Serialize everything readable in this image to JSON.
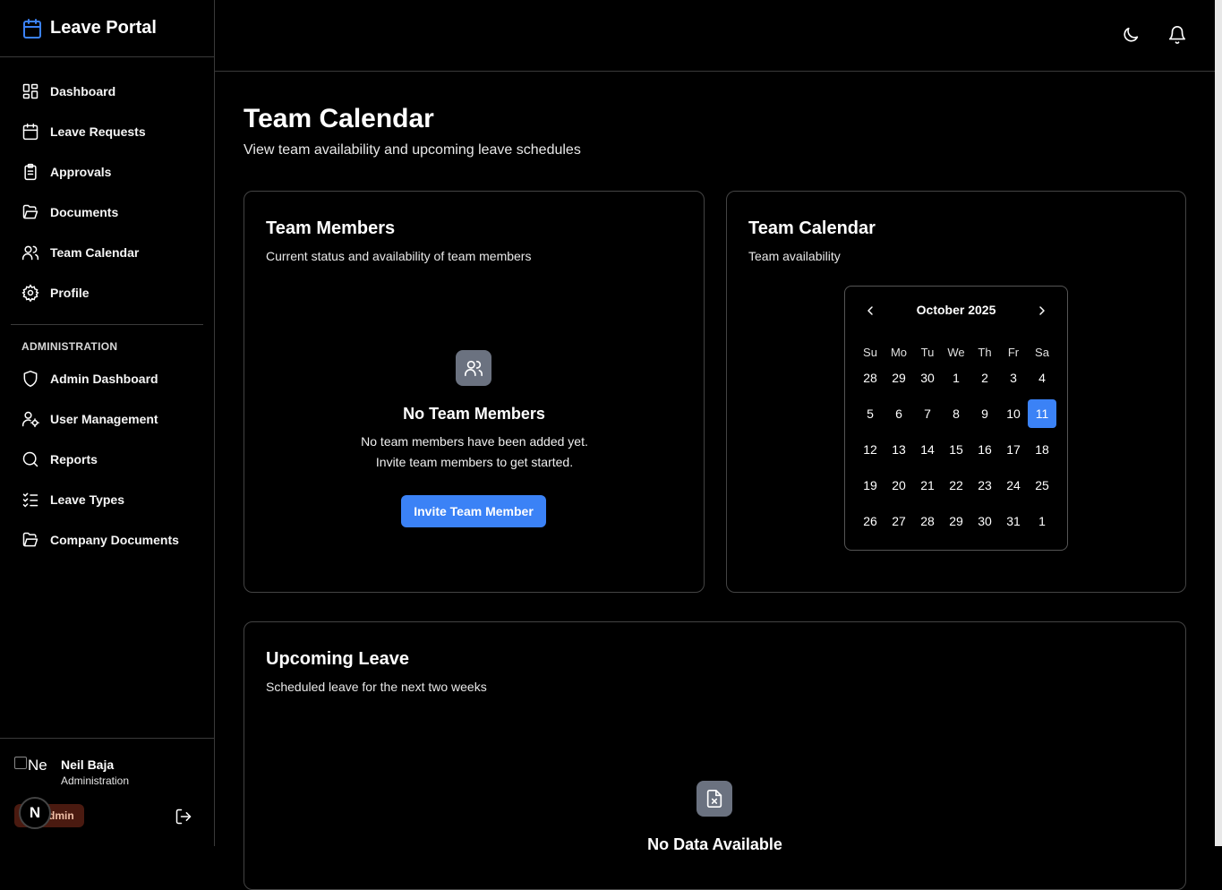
{
  "app": {
    "title": "Leave Portal"
  },
  "sidebar": {
    "items": [
      {
        "label": "Dashboard",
        "icon": "dashboard-icon"
      },
      {
        "label": "Leave Requests",
        "icon": "calendar-icon"
      },
      {
        "label": "Approvals",
        "icon": "clipboard-icon"
      },
      {
        "label": "Documents",
        "icon": "folder-open-icon"
      },
      {
        "label": "Team Calendar",
        "icon": "users-icon"
      },
      {
        "label": "Profile",
        "icon": "gear-icon"
      }
    ],
    "admin_section": "ADMINISTRATION",
    "admin_items": [
      {
        "label": "Admin Dashboard",
        "icon": "shield-icon"
      },
      {
        "label": "User Management",
        "icon": "user-cog-icon"
      },
      {
        "label": "Reports",
        "icon": "search-icon"
      },
      {
        "label": "Leave Types",
        "icon": "list-checks-icon"
      },
      {
        "label": "Company Documents",
        "icon": "folder-open-icon"
      }
    ],
    "user": {
      "name": "Neil Baja",
      "role": "Administration",
      "avatar_alt": "Ne",
      "badge": "dmin",
      "n_badge": "N"
    }
  },
  "page": {
    "title": "Team Calendar",
    "subtitle": "View team availability and upcoming leave schedules"
  },
  "team_members": {
    "title": "Team Members",
    "description": "Current status and availability of team members",
    "empty_title": "No Team Members",
    "empty_text": "No team members have been added yet. Invite team members to get started.",
    "button": "Invite Team Member"
  },
  "team_calendar": {
    "title": "Team Calendar",
    "description": "Team availability",
    "month": "October 2025",
    "weekdays": [
      "Su",
      "Mo",
      "Tu",
      "We",
      "Th",
      "Fr",
      "Sa"
    ],
    "weeks": [
      [
        "28",
        "29",
        "30",
        "1",
        "2",
        "3",
        "4"
      ],
      [
        "5",
        "6",
        "7",
        "8",
        "9",
        "10",
        "11"
      ],
      [
        "12",
        "13",
        "14",
        "15",
        "16",
        "17",
        "18"
      ],
      [
        "19",
        "20",
        "21",
        "22",
        "23",
        "24",
        "25"
      ],
      [
        "26",
        "27",
        "28",
        "29",
        "30",
        "31",
        "1"
      ]
    ],
    "selected_day": "11"
  },
  "upcoming_leave": {
    "title": "Upcoming Leave",
    "description": "Scheduled leave for the next two weeks",
    "empty_title": "No Data Available"
  },
  "colors": {
    "accent": "#3b82f6",
    "brand_icon": "#3b82f6",
    "badge_bg": "#4a1a10"
  }
}
